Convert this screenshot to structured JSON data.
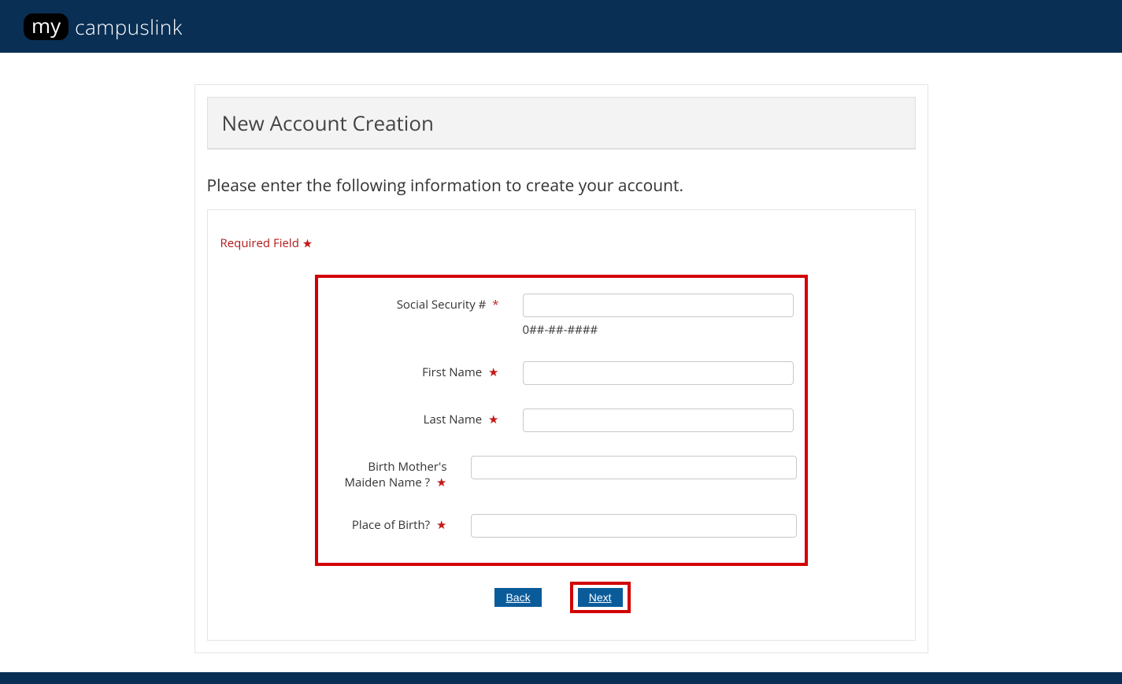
{
  "brand": {
    "pill": "my",
    "rest": "campuslink"
  },
  "panel": {
    "title": "New Account Creation"
  },
  "instruction": "Please enter the following information to create your account.",
  "required_legend": "Required Field",
  "fields": {
    "ssn": {
      "label": "Social Security #",
      "hint": "0##-##-####",
      "value": ""
    },
    "first": {
      "label": "First Name",
      "value": ""
    },
    "last": {
      "label": "Last Name",
      "value": ""
    },
    "maiden": {
      "label": "Birth Mother's Maiden Name ?",
      "value": ""
    },
    "pob": {
      "label": "Place of Birth?",
      "value": ""
    }
  },
  "buttons": {
    "back": "Back",
    "next": "Next"
  }
}
